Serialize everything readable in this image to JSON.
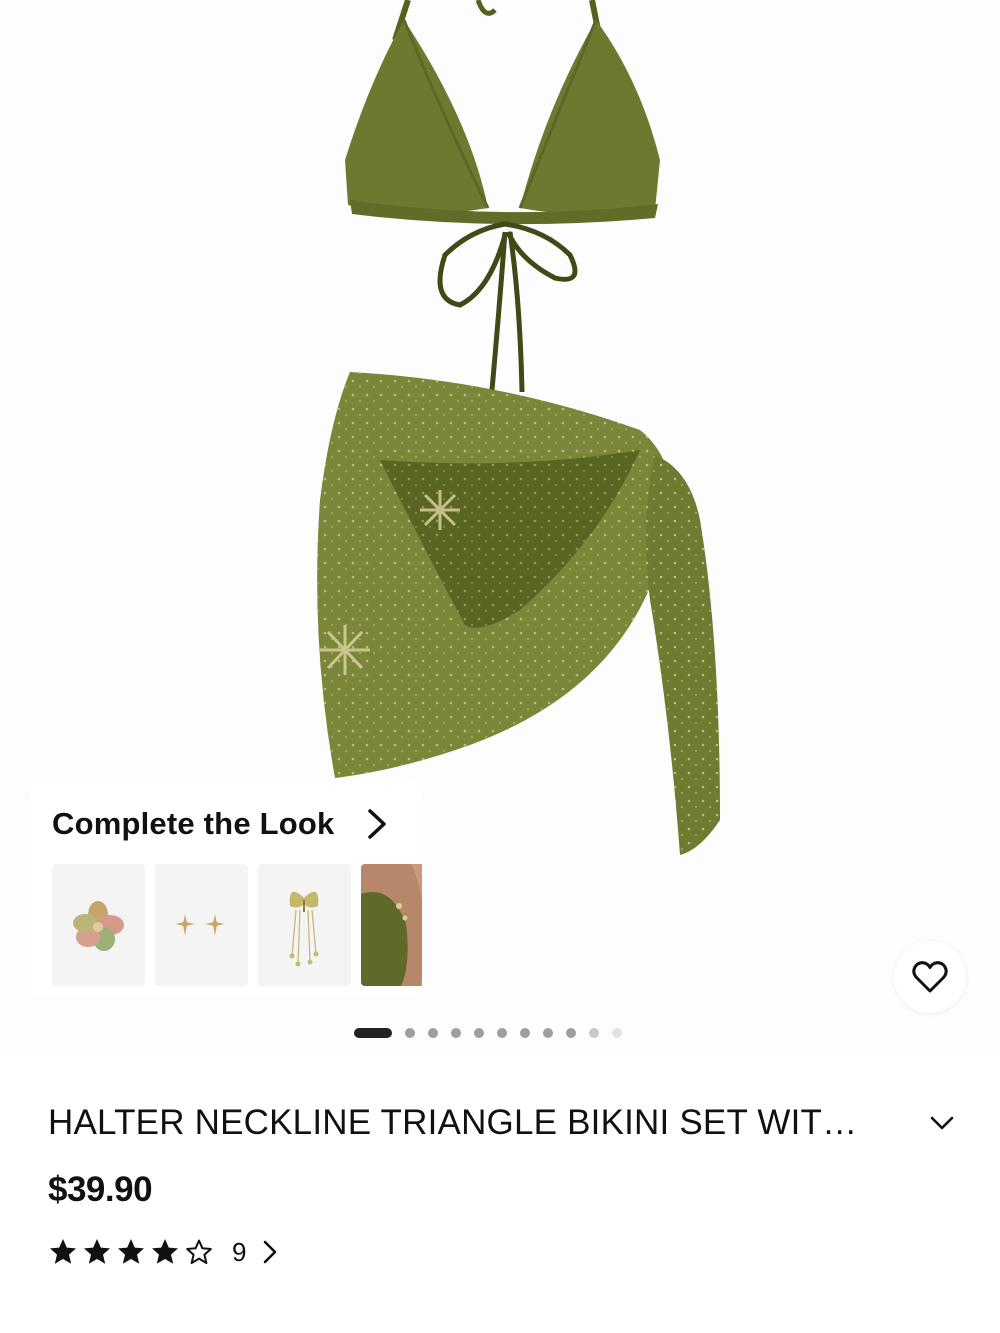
{
  "gallery": {
    "image_alt": "Olive green halter triangle bikini set with beaded sheer sarong",
    "slide_count": 12,
    "active_slide": 1
  },
  "complete_the_look": {
    "title": "Complete the Look",
    "items": [
      {
        "name": "flower-hair-clip"
      },
      {
        "name": "flower-stud-earrings"
      },
      {
        "name": "butterfly-tassel-earrings"
      },
      {
        "name": "model-wearing-set"
      }
    ]
  },
  "product": {
    "title": "HALTER NECKLINE TRIANGLE BIKINI SET WIT…",
    "price": "$39.90",
    "rating": 4,
    "rating_max": 5,
    "review_count": "9"
  },
  "colors": {
    "olive": "#6b7a2f",
    "olive_dark": "#4f5c1f",
    "olive_light": "#8a9541",
    "text": "#111111"
  }
}
